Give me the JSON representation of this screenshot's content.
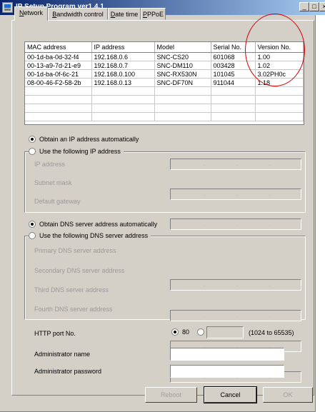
{
  "window": {
    "title": "IP Setup Program ver1.4.1",
    "minimize_glyph": "_",
    "restore_glyph": "□",
    "close_glyph": "×"
  },
  "tabs": [
    {
      "pre": "",
      "accel": "N",
      "post": "etwork"
    },
    {
      "pre": "",
      "accel": "B",
      "post": "andwidth control"
    },
    {
      "pre": "",
      "accel": "D",
      "post": "ate time"
    },
    {
      "pre": "",
      "accel": "P",
      "post": "PPoE"
    }
  ],
  "table": {
    "headers": [
      "MAC address",
      "IP address",
      "Model",
      "Serial No.",
      "Version No."
    ],
    "rows": [
      [
        "00-1d-ba-0d-32-f4",
        "192.168.0.6",
        "SNC-CS20",
        "601068",
        "1.00"
      ],
      [
        "00-13-a9-7d-21-e9",
        "192.168.0.7",
        "SNC-DM110",
        "003428",
        "1.02"
      ],
      [
        "00-1d-ba-0f-6c-21",
        "192.168.0.100",
        "SNC-RX530N",
        "101045",
        "3.02PH0c"
      ],
      [
        "08-00-46-F2-58-2b",
        "192.168.0.13",
        "SNC-DF70N",
        "911044",
        "1.18"
      ]
    ]
  },
  "ip": {
    "auto_label": "Obtain an IP address automatically",
    "manual_label": "Use the following IP address",
    "fields": [
      "IP address",
      "Subnet mask",
      "Default gateway"
    ]
  },
  "dns": {
    "auto_label": "Obtain DNS server address automatically",
    "manual_label": "Use the following DNS server address",
    "fields": [
      "Primary DNS server address",
      "Secondary DNS server address",
      "Third DNS server address",
      "Fourth DNS server address"
    ]
  },
  "http": {
    "label": "HTTP port No.",
    "option_80": "80",
    "range": "(1024 to 65535)"
  },
  "admin": {
    "name_label": "Administrator name",
    "password_label": "Administrator password"
  },
  "buttons": {
    "reboot": "Reboot",
    "cancel": "Cancel",
    "ok": "OK"
  },
  "colors": {
    "annotation_circle": "#d00000",
    "titlebar": "#0a246a"
  }
}
